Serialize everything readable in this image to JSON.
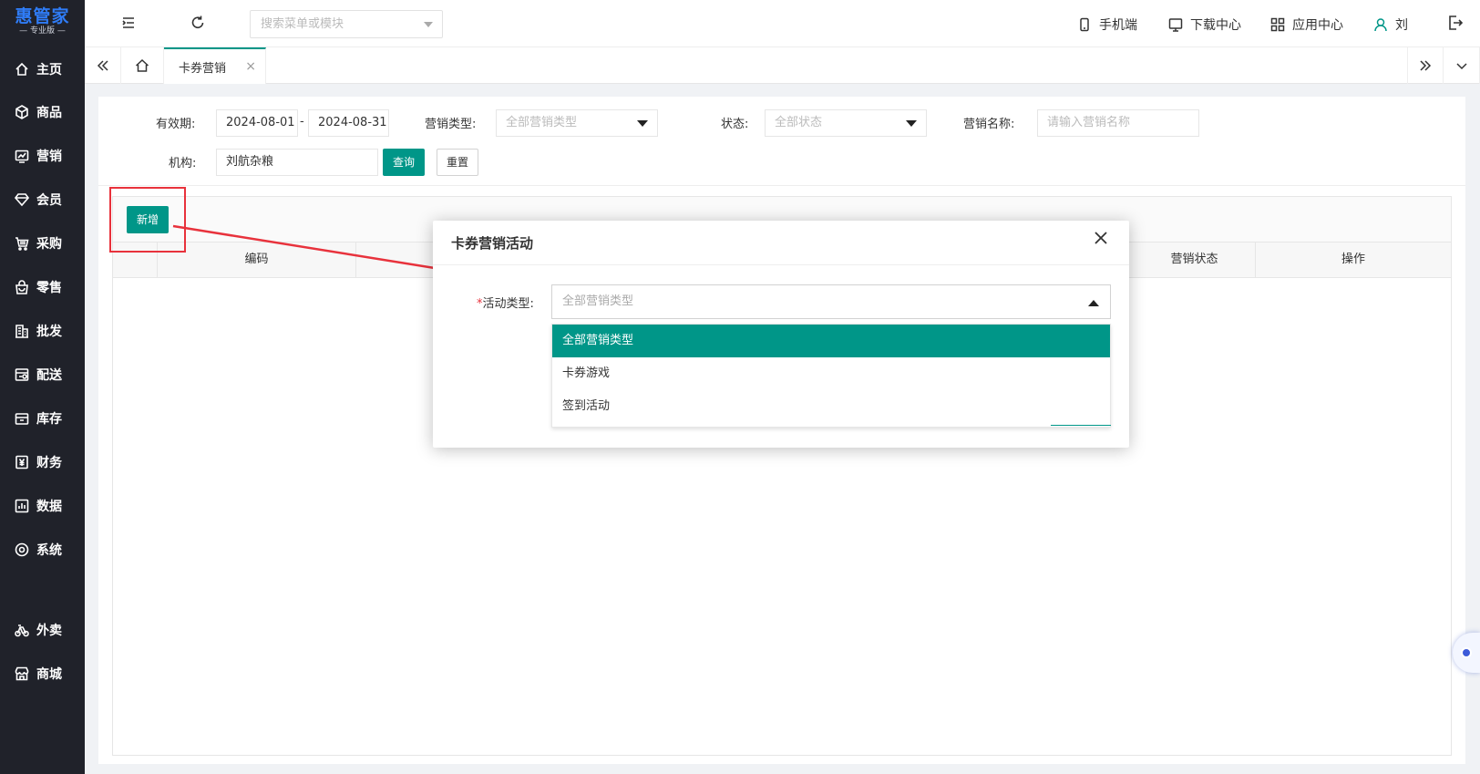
{
  "app": {
    "logo_main": "惠管家",
    "logo_sub": "— 专业版 —"
  },
  "sidebar": {
    "items": [
      {
        "label": "主页",
        "icon": "home-icon"
      },
      {
        "label": "商品",
        "icon": "cube-icon"
      },
      {
        "label": "营销",
        "icon": "chart-icon"
      },
      {
        "label": "会员",
        "icon": "diamond-icon"
      },
      {
        "label": "采购",
        "icon": "cart-icon"
      },
      {
        "label": "零售",
        "icon": "bag-icon"
      },
      {
        "label": "批发",
        "icon": "building-icon"
      },
      {
        "label": "配送",
        "icon": "delivery-icon"
      },
      {
        "label": "库存",
        "icon": "inventory-icon"
      },
      {
        "label": "财务",
        "icon": "yen-icon"
      },
      {
        "label": "数据",
        "icon": "data-icon"
      },
      {
        "label": "系统",
        "icon": "settings-icon"
      },
      {
        "label": "外卖",
        "icon": "bike-icon"
      },
      {
        "label": "商城",
        "icon": "store-icon"
      }
    ]
  },
  "header": {
    "search_placeholder": "搜索菜单或模块",
    "mobile_label": "手机端",
    "download_label": "下载中心",
    "apps_label": "应用中心",
    "user_label": "刘"
  },
  "tabs": {
    "active_label": "卡券营销",
    "close": "×"
  },
  "filters": {
    "validity_label": "有效期:",
    "date_start": "2024-08-01",
    "date_sep": "-",
    "date_end": "2024-08-31",
    "type_label": "营销类型:",
    "type_placeholder": "全部营销类型",
    "status_label": "状态:",
    "status_placeholder": "全部状态",
    "name_label": "营销名称:",
    "name_placeholder": "请输入营销名称",
    "org_label": "机构:",
    "org_value": "刘航杂粮",
    "query_button": "查询",
    "reset_button": "重置"
  },
  "toolbar": {
    "add_button": "新增"
  },
  "table": {
    "columns": [
      "编码",
      "营销状态",
      "操作"
    ]
  },
  "modal": {
    "title": "卡券营销活动",
    "required_mark": "*",
    "field_label": "活动类型:",
    "select_placeholder": "全部营销类型",
    "options": [
      "全部营销类型",
      "卡券游戏",
      "签到活动"
    ],
    "selected_index": 0
  },
  "colors": {
    "accent": "#009688",
    "sidebar_bg": "#20222a",
    "annotation_red": "#e8323c",
    "logo_blue": "#2f7cf6"
  }
}
